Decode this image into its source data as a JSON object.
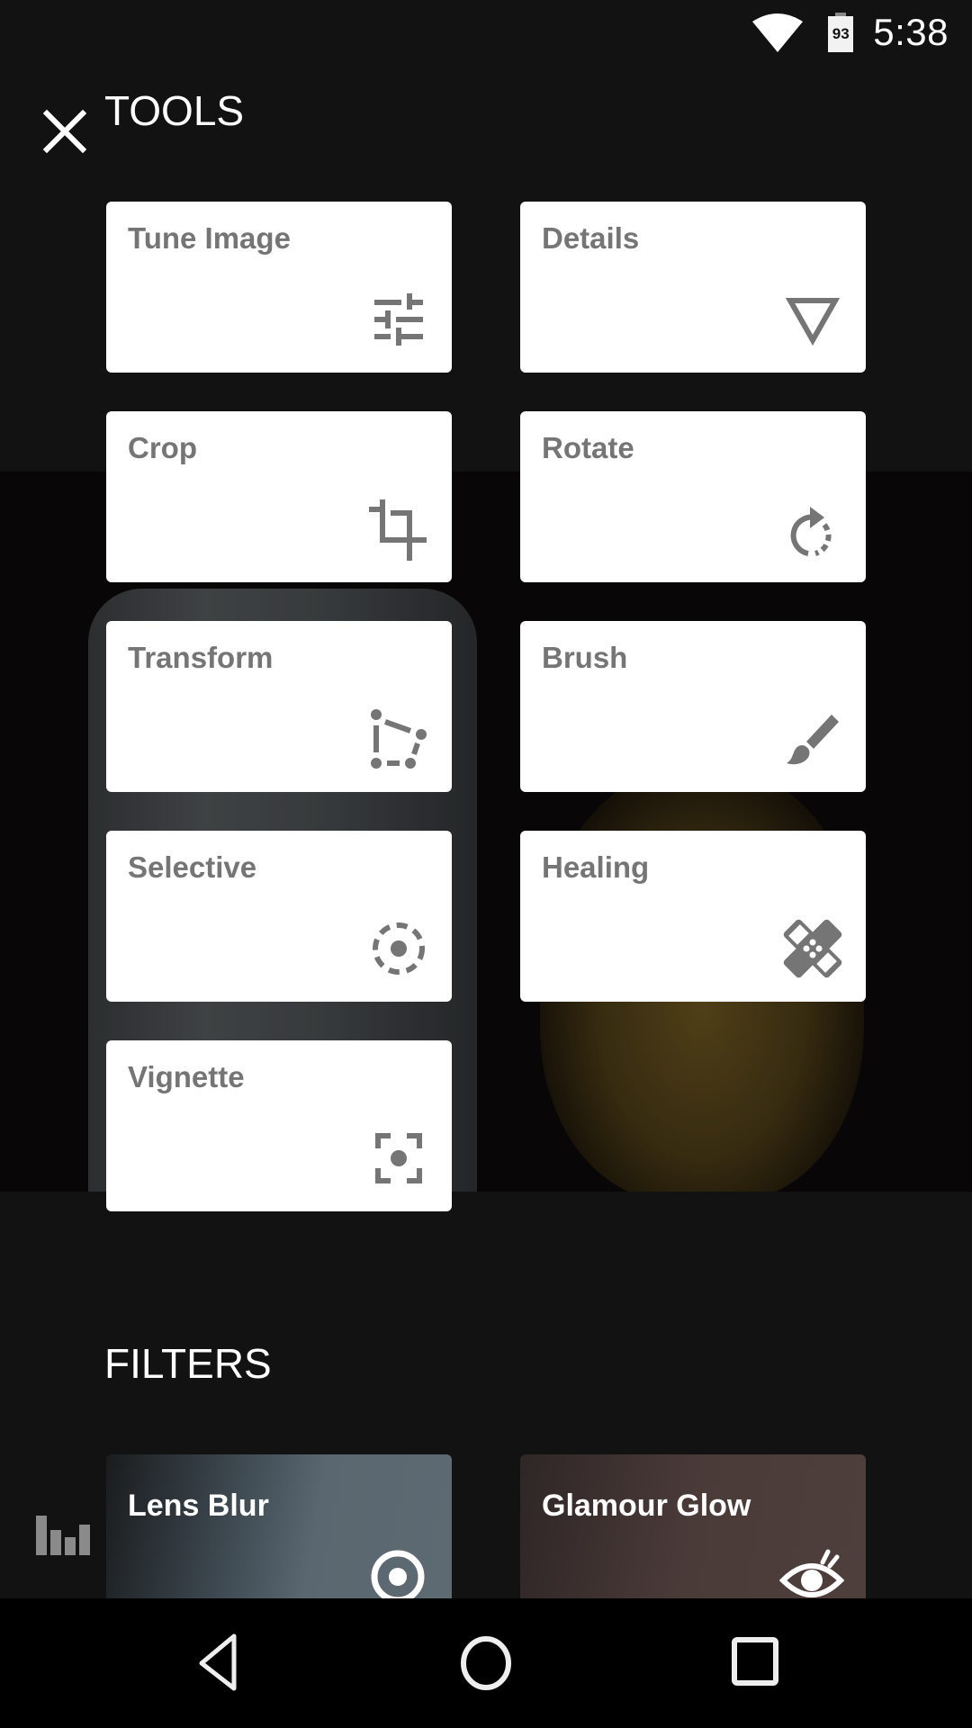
{
  "status_bar": {
    "wifi_icon": "wifi-icon",
    "battery_icon": "battery-icon",
    "battery_level": "93",
    "time": "5:38"
  },
  "header": {
    "close_icon": "close-icon",
    "title": "TOOLS"
  },
  "tools": [
    {
      "label": "Tune Image",
      "icon": "sliders-icon"
    },
    {
      "label": "Details",
      "icon": "triangle-down-icon"
    },
    {
      "label": "Crop",
      "icon": "crop-icon"
    },
    {
      "label": "Rotate",
      "icon": "rotate-icon"
    },
    {
      "label": "Transform",
      "icon": "perspective-icon"
    },
    {
      "label": "Brush",
      "icon": "brush-icon"
    },
    {
      "label": "Selective",
      "icon": "selective-target-icon"
    },
    {
      "label": "Healing",
      "icon": "bandage-icon"
    },
    {
      "label": "Vignette",
      "icon": "vignette-focus-icon"
    }
  ],
  "filters": {
    "title": "FILTERS",
    "items": [
      {
        "label": "Lens Blur",
        "icon": "lens-blur-icon"
      },
      {
        "label": "Glamour Glow",
        "icon": "eye-icon"
      }
    ]
  },
  "side_button": {
    "icon": "histogram-icon"
  },
  "nav_bar": {
    "back_icon": "back-icon",
    "home_icon": "home-icon",
    "recents_icon": "recents-icon"
  },
  "colors": {
    "background": "#121212",
    "tile_bg": "#ffffff",
    "tile_text": "#757575",
    "icon_gray": "#757575"
  }
}
